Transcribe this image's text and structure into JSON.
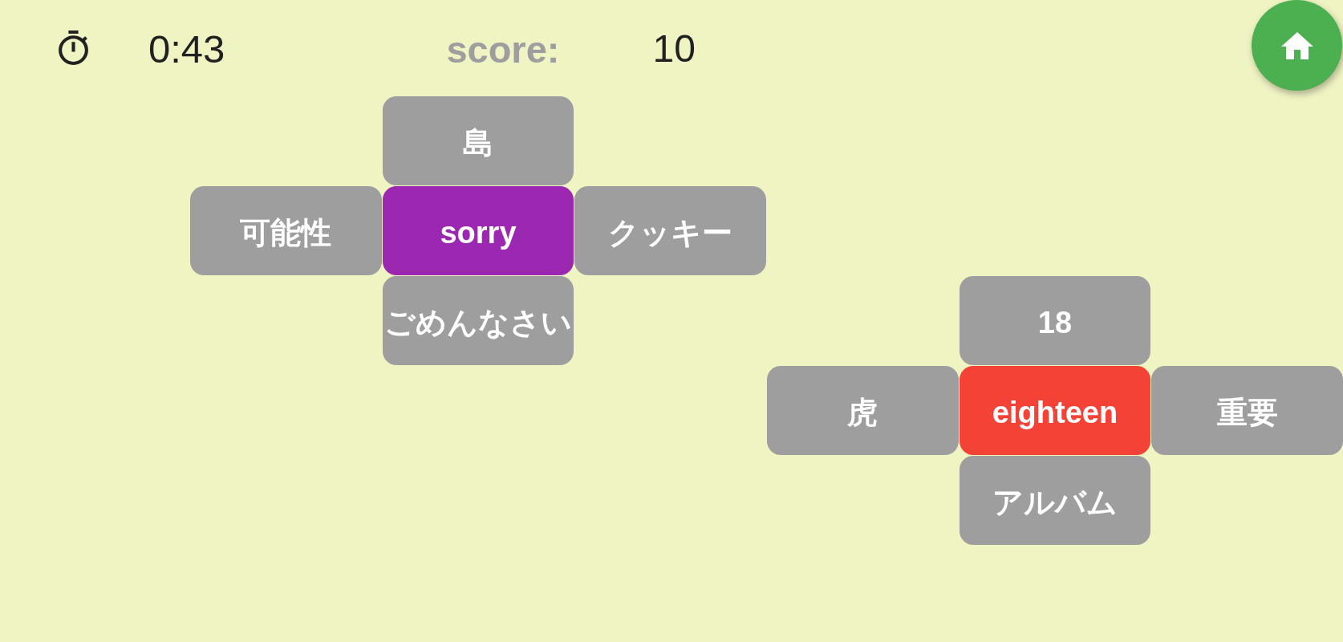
{
  "top_bar": {
    "timer": "0:43",
    "score_label": "score:",
    "score": "10"
  },
  "clusters": [
    {
      "word": {
        "label": "sorry",
        "color": "#9c27b0"
      },
      "choices": [
        {
          "kind": "top",
          "label": "島"
        },
        {
          "kind": "left",
          "label": "可能性"
        },
        {
          "kind": "right",
          "label": "クッキー"
        },
        {
          "kind": "bottom",
          "label": "ごめんなさい"
        }
      ]
    },
    {
      "word": {
        "label": "eighteen",
        "color": "#f44336"
      },
      "choices": [
        {
          "kind": "top",
          "label": "18"
        },
        {
          "kind": "left",
          "label": "虎"
        },
        {
          "kind": "right",
          "label": "重要"
        },
        {
          "kind": "bottom",
          "label": "アルバム"
        }
      ]
    }
  ]
}
